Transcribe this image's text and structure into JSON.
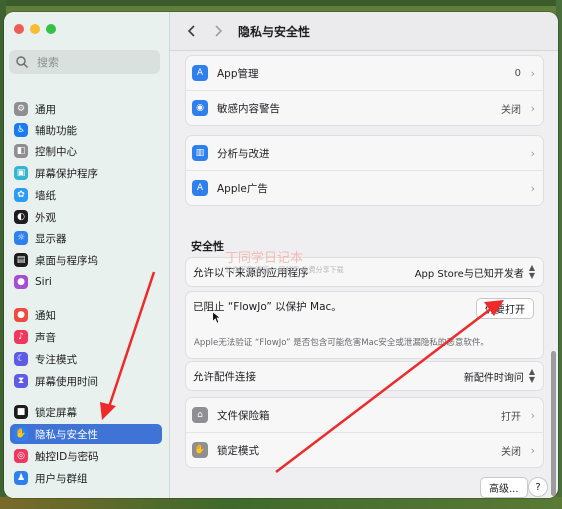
{
  "window": {
    "title": "隐私与安全性"
  },
  "sidebar": {
    "search_placeholder": "搜索",
    "items": [
      {
        "label": "通用",
        "icon": "gear-icon",
        "color": "#8e8e93"
      },
      {
        "label": "辅助功能",
        "icon": "accessibility-icon",
        "color": "#1a7cf5"
      },
      {
        "label": "控制中心",
        "icon": "control-center-icon",
        "color": "#8e8e93"
      },
      {
        "label": "屏幕保护程序",
        "icon": "screensaver-icon",
        "color": "#35b6d0"
      },
      {
        "label": "墙纸",
        "icon": "wallpaper-icon",
        "color": "#2b9cf3"
      },
      {
        "label": "外观",
        "icon": "appearance-icon",
        "color": "#1d1d1f"
      },
      {
        "label": "显示器",
        "icon": "display-icon",
        "color": "#2f80ed"
      },
      {
        "label": "桌面与程序坞",
        "icon": "dock-icon",
        "color": "#1d1d1f"
      },
      {
        "label": "Siri",
        "icon": "siri-icon",
        "color": "#a64dd6"
      },
      {
        "label": "通知",
        "icon": "notification-icon",
        "color": "#f04a3e"
      },
      {
        "label": "声音",
        "icon": "sound-icon",
        "color": "#f0385e"
      },
      {
        "label": "专注模式",
        "icon": "focus-icon",
        "color": "#5e5ce6"
      },
      {
        "label": "屏幕使用时间",
        "icon": "screen-time-icon",
        "color": "#5e5ce6"
      },
      {
        "label": "锁定屏幕",
        "icon": "lock-screen-icon",
        "color": "#1d1d1f"
      },
      {
        "label": "隐私与安全性",
        "icon": "hand-icon",
        "color": "#2f80ed",
        "selected": true
      },
      {
        "label": "触控ID与密码",
        "icon": "fingerprint-icon",
        "color": "#f0385e"
      },
      {
        "label": "用户与群组",
        "icon": "users-icon",
        "color": "#2f80ed"
      }
    ]
  },
  "privacy_rows": [
    {
      "label": "App管理",
      "value": "0",
      "icon": "app-management-icon",
      "color": "#2f80ed"
    },
    {
      "label": "敏感内容警告",
      "value": "关闭",
      "icon": "sensitive-content-icon",
      "color": "#2f80ed"
    }
  ],
  "analytics_rows": [
    {
      "label": "分析与改进",
      "icon": "analytics-icon",
      "color": "#2f80ed"
    },
    {
      "label": "Apple广告",
      "icon": "ads-icon",
      "color": "#2f80ed"
    }
  ],
  "security": {
    "section_title": "安全性",
    "allow_label": "允许以下来源的应用程序",
    "allow_value": "App Store与已知开发者",
    "blocked_label": "已阻止 “FlowJo” 以保护 Mac。",
    "open_anyway": "仍要打开",
    "blocked_note": "Apple无法验证 “FlowJo” 是否包含可能危害Mac安全或泄漏隐私的恶意软件。",
    "accessory_label": "允许配件连接",
    "accessory_value": "新配件时询问"
  },
  "extra_rows": [
    {
      "label": "文件保险箱",
      "value": "打开",
      "icon": "filevault-icon",
      "color": "#8e8e93"
    },
    {
      "label": "锁定模式",
      "value": "关闭",
      "icon": "lockdown-icon",
      "color": "#8e8e93"
    }
  ],
  "footer": {
    "advanced": "高级...",
    "help": "?"
  },
  "watermark": {
    "main": "丁同学日记本",
    "sub": "软件下载 资源 一网打尽 免费分享下载"
  }
}
